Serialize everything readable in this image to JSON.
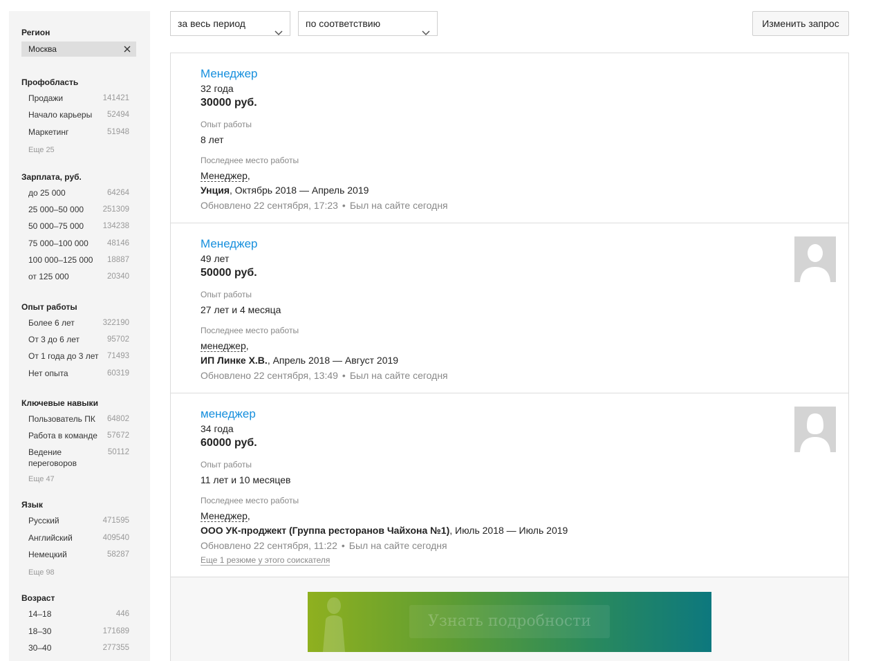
{
  "sidebar": {
    "region": {
      "heading": "Регион",
      "value": "Москва"
    },
    "prof": {
      "heading": "Профобласть",
      "items": [
        {
          "label": "Продажи",
          "count": "141421"
        },
        {
          "label": "Начало карьеры",
          "count": "52494"
        },
        {
          "label": "Маркетинг",
          "count": "51948"
        }
      ],
      "more": "Еще 25"
    },
    "salary": {
      "heading": "Зарплата, руб.",
      "items": [
        {
          "label": "до 25 000",
          "count": "64264"
        },
        {
          "label": "25 000–50 000",
          "count": "251309"
        },
        {
          "label": "50 000–75 000",
          "count": "134238"
        },
        {
          "label": "75 000–100 000",
          "count": "48146"
        },
        {
          "label": "100 000–125 000",
          "count": "18887"
        },
        {
          "label": "от 125 000",
          "count": "20340"
        }
      ]
    },
    "experience": {
      "heading": "Опыт работы",
      "items": [
        {
          "label": "Более 6 лет",
          "count": "322190"
        },
        {
          "label": "От 3 до 6 лет",
          "count": "95702"
        },
        {
          "label": "От 1 года до 3 лет",
          "count": "71493"
        },
        {
          "label": "Нет опыта",
          "count": "60319"
        }
      ]
    },
    "skills": {
      "heading": "Ключевые навыки",
      "items": [
        {
          "label": "Пользователь ПК",
          "count": "64802"
        },
        {
          "label": "Работа в команде",
          "count": "57672"
        },
        {
          "label": "Ведение переговоров",
          "count": "50112"
        }
      ],
      "more": "Еще 47"
    },
    "language": {
      "heading": "Язык",
      "items": [
        {
          "label": "Русский",
          "count": "471595"
        },
        {
          "label": "Английский",
          "count": "409540"
        },
        {
          "label": "Немецкий",
          "count": "58287"
        }
      ],
      "more": "Еще 98"
    },
    "age": {
      "heading": "Возраст",
      "items": [
        {
          "label": "14–18",
          "count": "446"
        },
        {
          "label": "18–30",
          "count": "171689"
        },
        {
          "label": "30–40",
          "count": "277355"
        }
      ]
    }
  },
  "toolbar": {
    "period": "за весь период",
    "sort": "по соответствию",
    "change_query": "Изменить запрос"
  },
  "resumes": [
    {
      "title": "Менеджер",
      "age": "32 года",
      "salary": "30000 руб.",
      "exp_label": "Опыт работы",
      "exp": "8 лет",
      "last_label": "Последнее место работы",
      "position": "Менеджер",
      "company": "Унция",
      "period": ", Октябрь 2018 — Апрель 2019",
      "updated": "Обновлено 22 сентября, 17:23",
      "online": "Был на сайте сегодня"
    },
    {
      "title": "Менеджер",
      "age": "49 лет",
      "salary": "50000 руб.",
      "exp_label": "Опыт работы",
      "exp": "27 лет и 4 месяца",
      "last_label": "Последнее место работы",
      "position": "менеджер",
      "company": "ИП Линке Х.В.",
      "period": ", Апрель 2018 — Август 2019",
      "updated": "Обновлено 22 сентября, 13:49",
      "online": "Был на сайте сегодня"
    },
    {
      "title": "менеджер",
      "age": "34 года",
      "salary": "60000 руб.",
      "exp_label": "Опыт работы",
      "exp": "11 лет и 10 месяцев",
      "last_label": "Последнее место работы",
      "position": "Менеджер",
      "company": "ООО УК-проджект (Группа ресторанов Чайхона №1)",
      "period": ", Июль 2018 — Июль 2019",
      "updated": "Обновлено 22 сентября, 11:22",
      "online": "Был на сайте сегодня",
      "more": "Еще 1 резюме у этого соискателя"
    }
  ],
  "banner": {
    "button": "Узнать подробности"
  },
  "icons": {
    "remove": "close-icon",
    "dropdown": "chevron-down-icon",
    "avatar": "user-silhouette-icon"
  }
}
